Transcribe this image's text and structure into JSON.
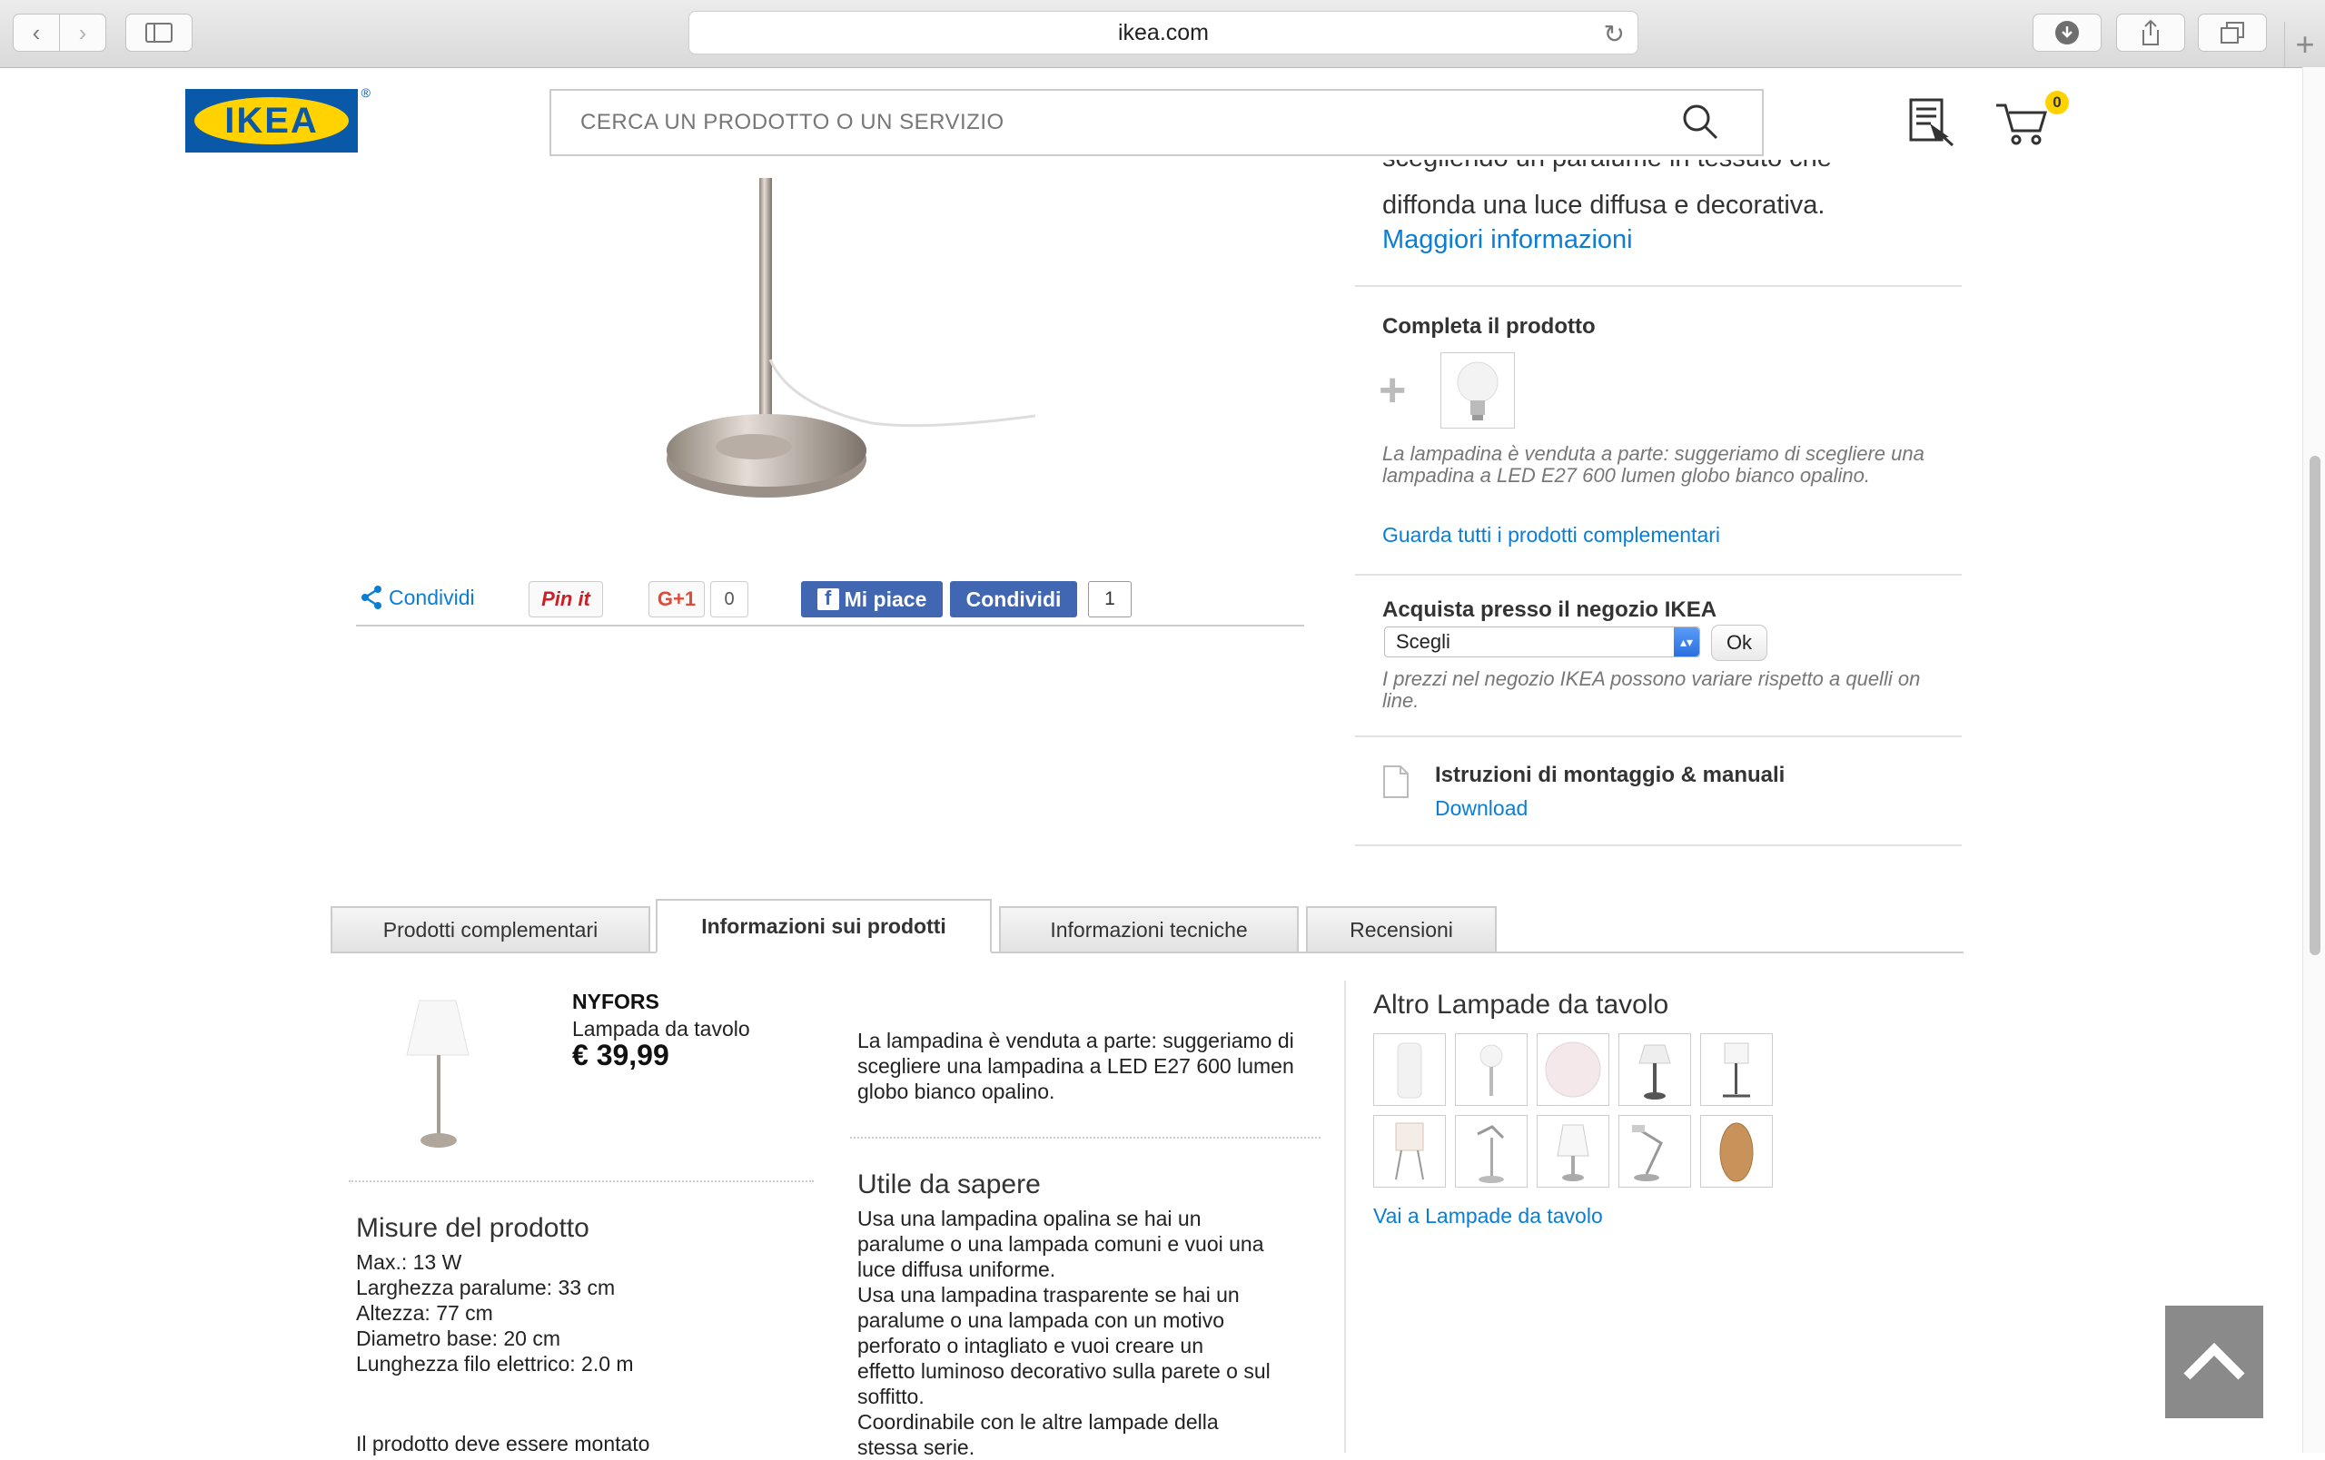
{
  "browser": {
    "url": "ikea.com"
  },
  "header": {
    "logo_text": "IKEA",
    "logo_reg": "®",
    "search_placeholder": "CERCA UN PRODOTTO O UN SERVIZIO",
    "cart_count": "0"
  },
  "share": {
    "share_label": "Condividi",
    "pinit_label": "Pin it",
    "gplus_label": "G+1",
    "gplus_count": "0",
    "fb_like_label": "Mi piace",
    "fb_share_label": "Condividi",
    "fb_count": "1"
  },
  "right_panel": {
    "desc_cut": "scegliendo un paralume in tessuto che",
    "desc_line": "diffonda una luce diffusa e decorativa.",
    "more_info_link": "Maggiori informazioni",
    "complete_heading": "Completa il prodotto",
    "complete_note": "La lampadina è venduta a parte: suggeriamo di scegliere una lampadina a LED E27 600 lumen globo bianco opalino.",
    "complete_link": "Guarda tutti i prodotti complementari",
    "store_heading": "Acquista presso il negozio IKEA",
    "store_select": "Scegli",
    "store_ok": "Ok",
    "store_note": "I prezzi nel negozio IKEA possono variare rispetto a quelli on line.",
    "manuals_heading": "Istruzioni di montaggio & manuali",
    "manuals_link": "Download"
  },
  "tabs": [
    {
      "label": "Prodotti complementari"
    },
    {
      "label": "Informazioni sui prodotti"
    },
    {
      "label": "Informazioni tecniche"
    },
    {
      "label": "Recensioni"
    }
  ],
  "product": {
    "name": "NYFORS",
    "type": "Lampada da tavolo",
    "price": "€ 39,99"
  },
  "measures": {
    "title": "Misure del prodotto",
    "lines": [
      "Max.: 13 W",
      "Larghezza paralume: 33 cm",
      "Altezza: 77 cm",
      "Diametro base: 20 cm",
      "Lunghezza filo elettrico: 2.0 m"
    ],
    "assembly_cut": "Il prodotto deve essere montato"
  },
  "info": {
    "bulb_note": "La lampadina è venduta a parte: suggeriamo di scegliere una lampadina a LED E27 600 lumen globo bianco opalino.",
    "useful_title": "Utile da sapere",
    "useful_lines": [
      "Usa una lampadina opalina se hai un",
      "paralume o una lampada comuni e vuoi una",
      "luce diffusa uniforme.",
      "Usa una lampadina trasparente se hai un",
      "paralume o una lampada con un motivo",
      "perforato o intagliato e vuoi creare un",
      "effetto luminoso decorativo sulla parete o sul",
      "soffitto.",
      "Coordinabile con le altre lampade della",
      "stessa serie."
    ]
  },
  "related": {
    "title": "Altro Lampade da tavolo",
    "link": "Vai a Lampade da tavolo"
  },
  "colors": {
    "ikea_blue": "#0a58a8",
    "ikea_yellow": "#ffd200",
    "link_blue": "#0a7ed6",
    "facebook_blue": "#4267b2"
  }
}
